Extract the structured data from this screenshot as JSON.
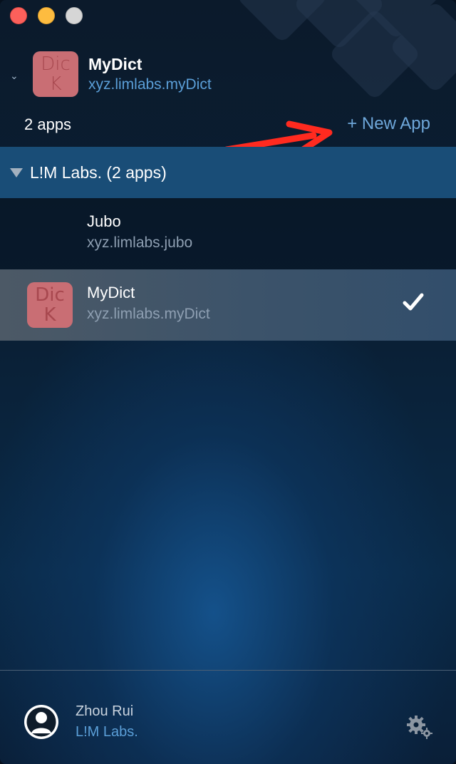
{
  "window": {
    "controls": [
      "close",
      "minimize",
      "zoom"
    ]
  },
  "current_app": {
    "icon_text_line1": "Dic",
    "icon_text_line2": "K",
    "name": "MyDict",
    "bundle_id": "xyz.limlabs.myDict"
  },
  "toolbar": {
    "apps_count": "2 apps",
    "new_app_label": "+ New App"
  },
  "group": {
    "label": "L!M Labs. (2 apps)"
  },
  "apps": [
    {
      "name": "Jubo",
      "bundle_id": "xyz.limlabs.jubo",
      "selected": false
    },
    {
      "name": "MyDict",
      "bundle_id": "xyz.limlabs.myDict",
      "icon_text_line1": "Dic",
      "icon_text_line2": "K",
      "selected": true
    }
  ],
  "user": {
    "name": "Zhou Rui",
    "org": "L!M Labs."
  },
  "colors": {
    "accent_link": "#5b9fd8",
    "group_header": "#194d77",
    "annotation_arrow": "#ff2a1f",
    "app_icon": "#c96e74"
  },
  "icons": {
    "chevron": "chevron-down-icon",
    "group_toggle": "disclosure-triangle-icon",
    "selected": "checkmark-icon",
    "settings": "gear-icon",
    "avatar": "user-avatar-icon",
    "annotation": "red-arrow-icon"
  }
}
